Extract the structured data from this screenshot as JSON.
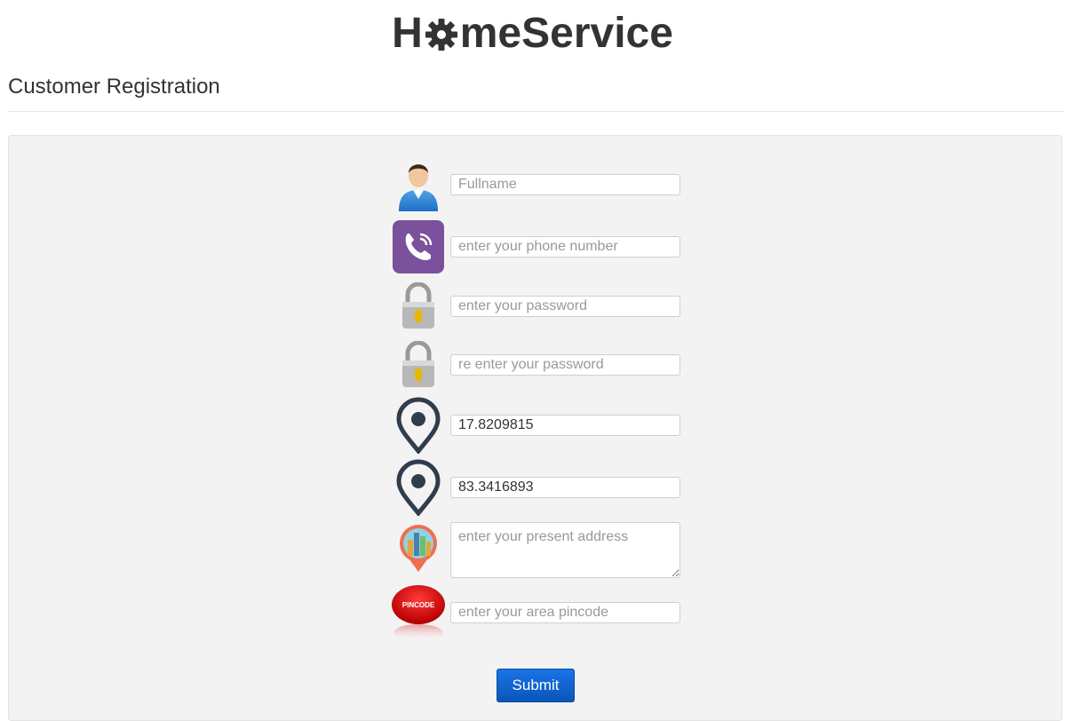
{
  "brand": {
    "prefix": "H",
    "suffix": "meService",
    "gear_icon": "gear-icon"
  },
  "page": {
    "heading": "Customer Registration"
  },
  "form": {
    "fullname": {
      "placeholder": "Fullname",
      "value": "",
      "icon": "user-icon"
    },
    "phone": {
      "placeholder": "enter your phone number",
      "value": "",
      "icon": "phone-icon"
    },
    "password": {
      "placeholder": "enter your password",
      "value": "",
      "icon": "lock-icon"
    },
    "confirm_password": {
      "placeholder": "re enter your password",
      "value": "",
      "icon": "lock-icon"
    },
    "latitude": {
      "placeholder": "",
      "value": "17.8209815",
      "icon": "map-pin-icon"
    },
    "longitude": {
      "placeholder": "",
      "value": "83.3416893",
      "icon": "map-pin-icon"
    },
    "address": {
      "placeholder": "enter your present address",
      "value": "",
      "icon": "city-pin-icon"
    },
    "pincode": {
      "placeholder": "enter your area pincode",
      "value": "",
      "icon": "pincode-icon",
      "icon_text": "PINCODE"
    },
    "submit_label": "Submit"
  },
  "colors": {
    "accent": "#1a73e8",
    "viber_purple": "#7b519d",
    "pin_dark": "#2f3d4c",
    "pincode_red": "#d90000"
  }
}
